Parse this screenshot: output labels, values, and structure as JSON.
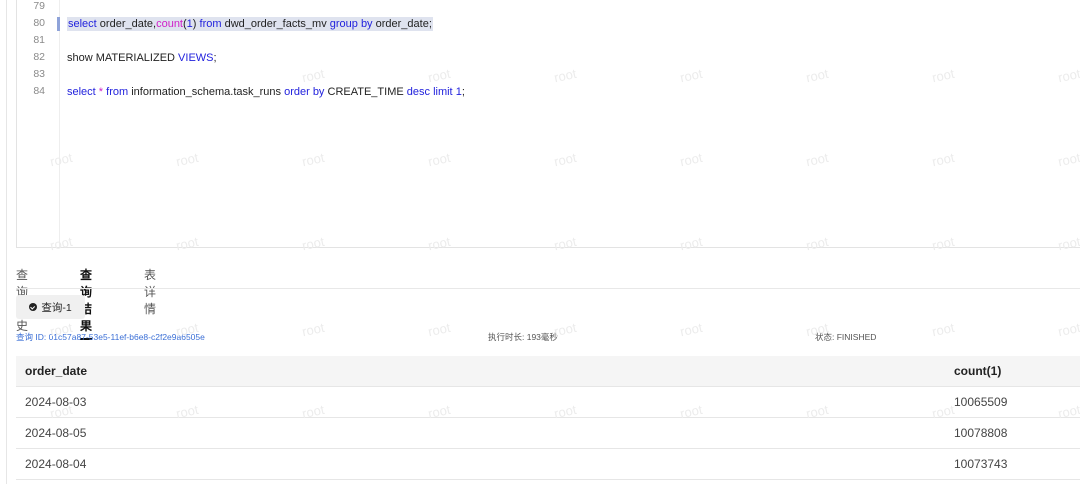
{
  "editor": {
    "lines": [
      {
        "no": "79",
        "segments": []
      },
      {
        "no": "80",
        "segments": [
          {
            "t": "select",
            "c": "kw"
          },
          {
            "t": " order_date,",
            "c": ""
          },
          {
            "t": "count",
            "c": "fn"
          },
          {
            "t": "(",
            "c": ""
          },
          {
            "t": "1",
            "c": "num"
          },
          {
            "t": ") ",
            "c": ""
          },
          {
            "t": "from",
            "c": "kw"
          },
          {
            "t": " dwd_order_facts_mv ",
            "c": ""
          },
          {
            "t": "group by",
            "c": "kw"
          },
          {
            "t": " order_date;",
            "c": ""
          }
        ]
      },
      {
        "no": "81",
        "segments": []
      },
      {
        "no": "82",
        "segments": [
          {
            "t": "show MATERIALIZED ",
            "c": ""
          },
          {
            "t": "VIEWS",
            "c": "kw"
          },
          {
            "t": ";",
            "c": ""
          }
        ]
      },
      {
        "no": "83",
        "segments": []
      },
      {
        "no": "84",
        "segments": [
          {
            "t": "select",
            "c": "kw"
          },
          {
            "t": " * ",
            "c": "fn"
          },
          {
            "t": "from",
            "c": "kw"
          },
          {
            "t": " information_schema.task_runs ",
            "c": ""
          },
          {
            "t": "order by",
            "c": "kw"
          },
          {
            "t": " CREATE_TIME ",
            "c": ""
          },
          {
            "t": "desc",
            "c": "kw"
          },
          {
            "t": " ",
            "c": ""
          },
          {
            "t": "limit",
            "c": "kw"
          },
          {
            "t": " ",
            "c": ""
          },
          {
            "t": "1",
            "c": "num"
          },
          {
            "t": ";",
            "c": ""
          }
        ]
      }
    ]
  },
  "watermark": "root",
  "tabs": [
    {
      "label": "查询历史",
      "active": false
    },
    {
      "label": "查询结果",
      "active": true
    },
    {
      "label": "表详情",
      "active": false
    }
  ],
  "query_chip": {
    "label": "查询-1",
    "icon": "check-circle-icon"
  },
  "meta": {
    "query_id": "查询 ID: 01c57a87-53e5-11ef-b6e8-c2f2e9a6505e",
    "duration": "执行时长: 193毫秒",
    "status": "状态: FINISHED"
  },
  "results": {
    "columns": [
      "order_date",
      "count(1)"
    ],
    "rows": [
      [
        "2024-08-03",
        "10065509"
      ],
      [
        "2024-08-05",
        "10078808"
      ],
      [
        "2024-08-04",
        "10073743"
      ]
    ]
  },
  "colors": {
    "keyword": "#2222dd",
    "function": "#d020c8",
    "selection": "#dfe3ef"
  }
}
